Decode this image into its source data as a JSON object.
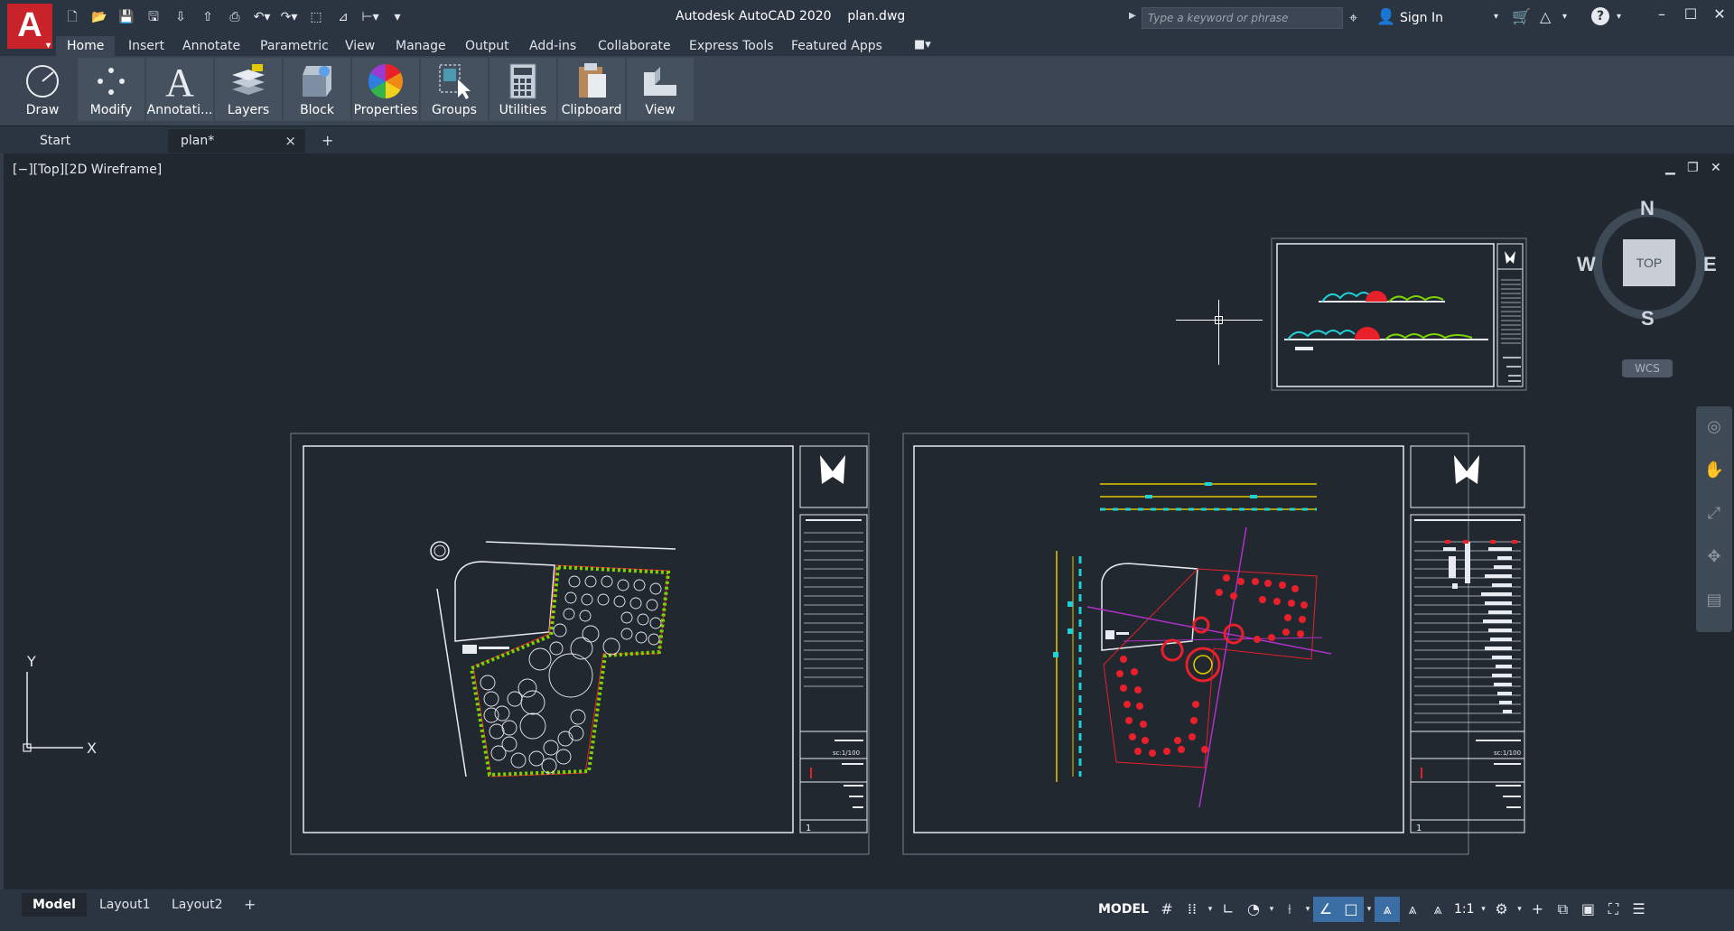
{
  "app": {
    "logo_letter": "A",
    "title": "Autodesk AutoCAD 2020    plan.dwg"
  },
  "quick_access": {
    "icons": [
      "new-icon",
      "open-icon",
      "save-icon",
      "save-as-icon",
      "open-from-web-icon",
      "save-to-web-icon",
      "plot-icon",
      "undo-icon",
      "redo-icon",
      "match-properties-icon",
      "purge-icon",
      "customize-caret-icon"
    ]
  },
  "search": {
    "placeholder": "Type a keyword or phrase"
  },
  "account": {
    "signin_label": "Sign In"
  },
  "ribbon": {
    "tabs": [
      {
        "label": "Home",
        "active": true
      },
      {
        "label": "Insert"
      },
      {
        "label": "Annotate"
      },
      {
        "label": "Parametric"
      },
      {
        "label": "View"
      },
      {
        "label": "Manage"
      },
      {
        "label": "Output"
      },
      {
        "label": "Add-ins"
      },
      {
        "label": "Collaborate"
      },
      {
        "label": "Express Tools"
      },
      {
        "label": "Featured Apps"
      }
    ],
    "panels": [
      {
        "label": "Draw",
        "icon": "draw-circle-icon"
      },
      {
        "label": "Modify",
        "icon": "modify-icon"
      },
      {
        "label": "Annotati...",
        "icon": "annotation-icon"
      },
      {
        "label": "Layers",
        "icon": "layers-icon"
      },
      {
        "label": "Block",
        "icon": "block-icon"
      },
      {
        "label": "Properties",
        "icon": "properties-color-wheel-icon"
      },
      {
        "label": "Groups",
        "icon": "groups-icon"
      },
      {
        "label": "Utilities",
        "icon": "utilities-calculator-icon"
      },
      {
        "label": "Clipboard",
        "icon": "clipboard-icon"
      },
      {
        "label": "View",
        "icon": "view-icon"
      }
    ]
  },
  "document_tabs": {
    "start": "Start",
    "plan": "plan*",
    "plan_close": "×",
    "add": "+"
  },
  "viewport": {
    "label": "[−][Top][2D Wireframe]",
    "min": "▁",
    "restore": "❐",
    "close": "✕"
  },
  "viewcube": {
    "face": "TOP",
    "north": "N",
    "south": "S",
    "west": "W",
    "east": "E",
    "wcs": "WCS"
  },
  "ucs": {
    "y_label": "Y",
    "x_label": "X"
  },
  "sheets": {
    "left_scale": "sc:1/100",
    "right_scale": "sc:1/100",
    "left_number": "1",
    "right_number": "1"
  },
  "layout_tabs": {
    "model": "Model",
    "layout1": "Layout1",
    "layout2": "Layout2",
    "add": "+"
  },
  "status": {
    "model_label": "MODEL",
    "scale": "1:1"
  },
  "colors": {
    "background": "#212830",
    "titlebar": "#2b3441",
    "ribbon": "#3b4553",
    "logo_red": "#c8232b",
    "accent_blue": "#3b6ea5",
    "drawing_yellow": "#e5c900",
    "drawing_cyan": "#22d0d8",
    "drawing_red": "#e8202a",
    "drawing_green": "#7dd400",
    "drawing_magenta": "#b030c8"
  }
}
